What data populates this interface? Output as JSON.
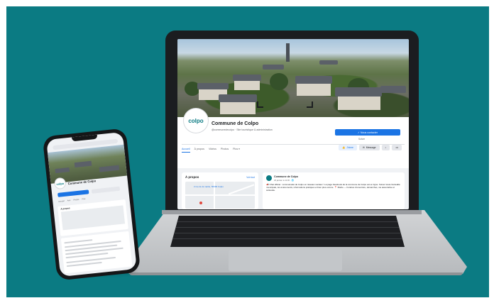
{
  "page": {
    "name": "Commune de Colpo",
    "subtitle": "@communedecolpo · Site touristique & administration",
    "logo_text": "colpo"
  },
  "actions": {
    "primary": "✓ Nous contacter",
    "follow": "J'aime",
    "message": "Message",
    "search_icon": "search-icon",
    "more": "•••",
    "followers": "Suivre"
  },
  "tabs": [
    "Accueil",
    "À propos",
    "Vidéos",
    "Photos",
    "Plus ▾"
  ],
  "about": {
    "title": "À propos",
    "see_all": "Voir tout",
    "address": "2 rue de la mairie, 56390 Colpo"
  },
  "post": {
    "author": "Commune de Colpo",
    "time": "23 janvier à 11:30 · 🌐",
    "text": "📣 Chat officiel : communauté de Colpo en réseaux sociaux ! La page Facebook de la commune de Colpo est en ligne. Suivez toute l'actualité municipale, les événements, informations pratiques et bien plus encore. 📍 Mairie — horaires d'ouverture, démarches, vie associative et culturelle."
  },
  "mobile": {
    "name": "Commune de Colpo",
    "logo_text": "colpo",
    "tabs": [
      "Accueil",
      "Avis",
      "Photos",
      "Plus"
    ],
    "about_title": "À propos"
  },
  "colors": {
    "background": "#0b7b83",
    "facebook_blue": "#1b74e4",
    "device_dark": "#1b1d20",
    "laptop_silver": "#c3c6c9"
  }
}
